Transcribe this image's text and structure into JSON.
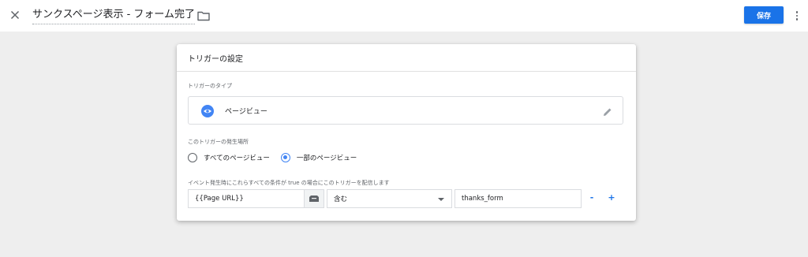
{
  "header": {
    "title": "サンクスページ表示 - フォーム完了",
    "save_label": "保存"
  },
  "card": {
    "title": "トリガーの設定",
    "type_label": "トリガーのタイプ",
    "type_name": "ページビュー",
    "fires_on_label": "このトリガーの発生場所",
    "radio_all": "すべてのページビュー",
    "radio_some": "一部のページビュー",
    "selected_radio": "一部のページビュー",
    "condition_label": "イベント発生時にこれらすべての条件が true の場合にこのトリガーを配信します",
    "condition": {
      "variable": "{{Page URL}}",
      "operator": "含む",
      "value": "thanks_form",
      "remove_label": "-",
      "add_label": "+"
    }
  },
  "colors": {
    "accent": "#1a73e8",
    "icon_blue": "#4285f4",
    "background": "#eeeeee"
  },
  "icons": [
    "close-icon",
    "folder-icon",
    "more-vert-icon",
    "eye-icon",
    "pencil-icon",
    "variable-icon",
    "dropdown-caret-icon"
  ]
}
